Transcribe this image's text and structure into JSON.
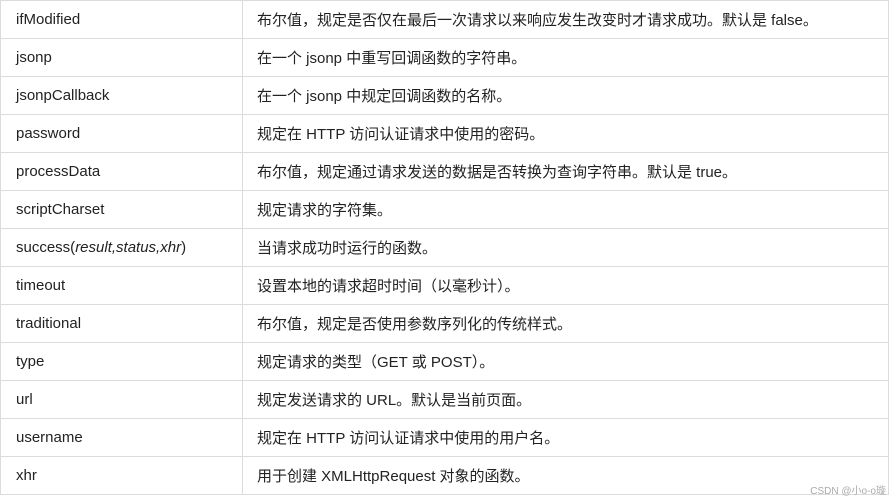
{
  "rows": [
    {
      "name": "ifModified",
      "desc": "布尔值，规定是否仅在最后一次请求以来响应发生改变时才请求成功。默认是 false。"
    },
    {
      "name": "jsonp",
      "desc": "在一个 jsonp 中重写回调函数的字符串。"
    },
    {
      "name": "jsonpCallback",
      "desc": "在一个 jsonp 中规定回调函数的名称。"
    },
    {
      "name": "password",
      "desc": "规定在 HTTP 访问认证请求中使用的密码。"
    },
    {
      "name": "processData",
      "desc": "布尔值，规定通过请求发送的数据是否转换为查询字符串。默认是 true。"
    },
    {
      "name": "scriptCharset",
      "desc": "规定请求的字符集。"
    },
    {
      "name": "success(",
      "name_args": "result,status,xhr",
      "name_end": ")",
      "desc": "当请求成功时运行的函数。"
    },
    {
      "name": "timeout",
      "desc": "设置本地的请求超时时间（以毫秒计）。"
    },
    {
      "name": "traditional",
      "desc": "布尔值，规定是否使用参数序列化的传统样式。"
    },
    {
      "name": "type",
      "desc": "规定请求的类型（GET 或 POST）。"
    },
    {
      "name": "url",
      "desc": "规定发送请求的 URL。默认是当前页面。"
    },
    {
      "name": "username",
      "desc": "规定在 HTTP 访问认证请求中使用的用户名。"
    },
    {
      "name": "xhr",
      "desc": "用于创建 XMLHttpRequest 对象的函数。"
    }
  ],
  "watermark": "CSDN @小o-o璇"
}
